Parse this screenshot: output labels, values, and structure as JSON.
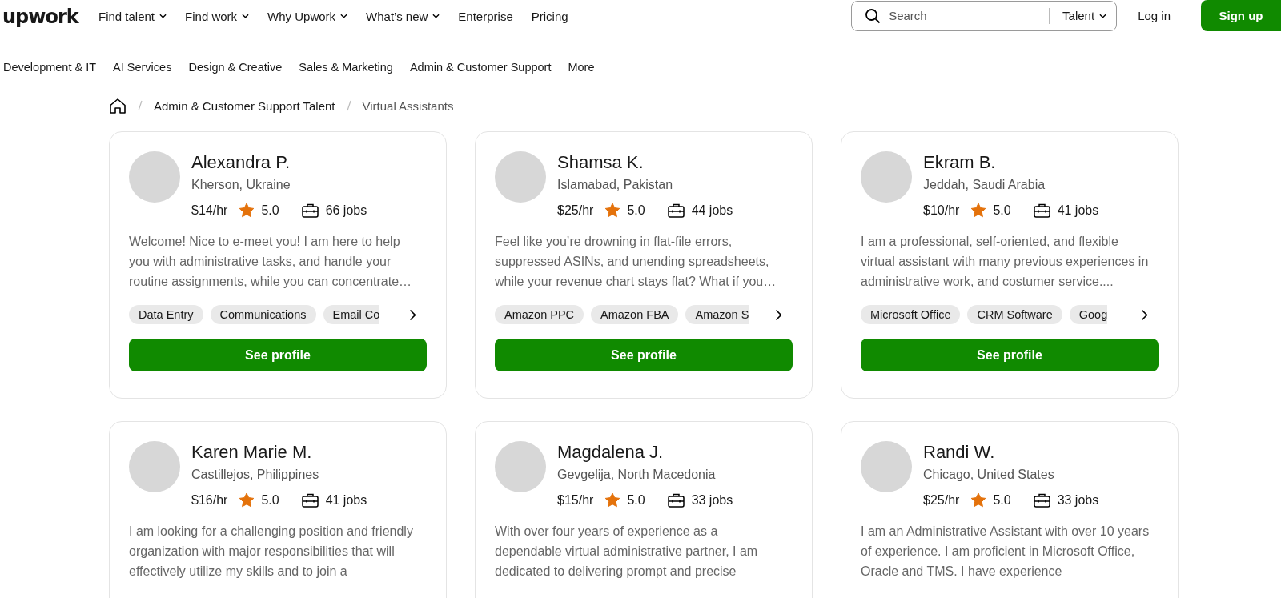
{
  "header": {
    "logo": "upwork",
    "nav": [
      {
        "label": "Find talent",
        "dropdown": true
      },
      {
        "label": "Find work",
        "dropdown": true
      },
      {
        "label": "Why Upwork",
        "dropdown": true
      },
      {
        "label": "What’s new",
        "dropdown": true
      },
      {
        "label": "Enterprise",
        "dropdown": false
      },
      {
        "label": "Pricing",
        "dropdown": false
      }
    ],
    "search": {
      "placeholder": "Search",
      "scope": "Talent"
    },
    "login": "Log in",
    "signup": "Sign up"
  },
  "categories": [
    "Development & IT",
    "AI Services",
    "Design & Creative",
    "Sales & Marketing",
    "Admin & Customer Support",
    "More"
  ],
  "breadcrumb": [
    "Admin & Customer Support Talent",
    "Virtual Assistants"
  ],
  "cards": [
    {
      "name": "Alexandra P.",
      "location": "Kherson, Ukraine",
      "rate": "$14/hr",
      "rating": "5.0",
      "jobs": "66 jobs",
      "description": "Welcome! Nice to e-meet you! I am here to help you with administrative tasks, and handle your routine assignments, while you can concentrate…",
      "skills": [
        "Data Entry",
        "Communications",
        "Email Co"
      ],
      "button": "See profile"
    },
    {
      "name": "Shamsa K.",
      "location": "Islamabad, Pakistan",
      "rate": "$25/hr",
      "rating": "5.0",
      "jobs": "44 jobs",
      "description": "Feel like you’re drowning in flat-file errors, suppressed ASINs, and unending spreadsheets, while your revenue chart stays flat? What if you…",
      "skills": [
        "Amazon PPC",
        "Amazon FBA",
        "Amazon S"
      ],
      "button": "See profile"
    },
    {
      "name": "Ekram B.",
      "location": "Jeddah, Saudi Arabia",
      "rate": "$10/hr",
      "rating": "5.0",
      "jobs": "41 jobs",
      "description": "I am a professional, self-oriented, and flexible virtual assistant with many previous experiences in administrative work, and costumer service....",
      "skills": [
        "Microsoft Office",
        "CRM Software",
        "Goog"
      ],
      "button": "See profile"
    },
    {
      "name": "Karen Marie M.",
      "location": "Castillejos, Philippines",
      "rate": "$16/hr",
      "rating": "5.0",
      "jobs": "41 jobs",
      "description": "I am looking for a challenging position and friendly organization with major responsibilities that will effectively utilize my skills and to join a"
    },
    {
      "name": "Magdalena J.",
      "location": "Gevgelija, North Macedonia",
      "rate": "$15/hr",
      "rating": "5.0",
      "jobs": "33 jobs",
      "description": "With over four years of experience as a dependable virtual administrative partner, I am dedicated to delivering prompt and precise"
    },
    {
      "name": "Randi W.",
      "location": "Chicago, United States",
      "rate": "$25/hr",
      "rating": "5.0",
      "jobs": "33 jobs",
      "description": "I am an Administrative Assistant with over 10 years of experience. I am proficient in Microsoft Office, Oracle and TMS. I have experience"
    }
  ]
}
